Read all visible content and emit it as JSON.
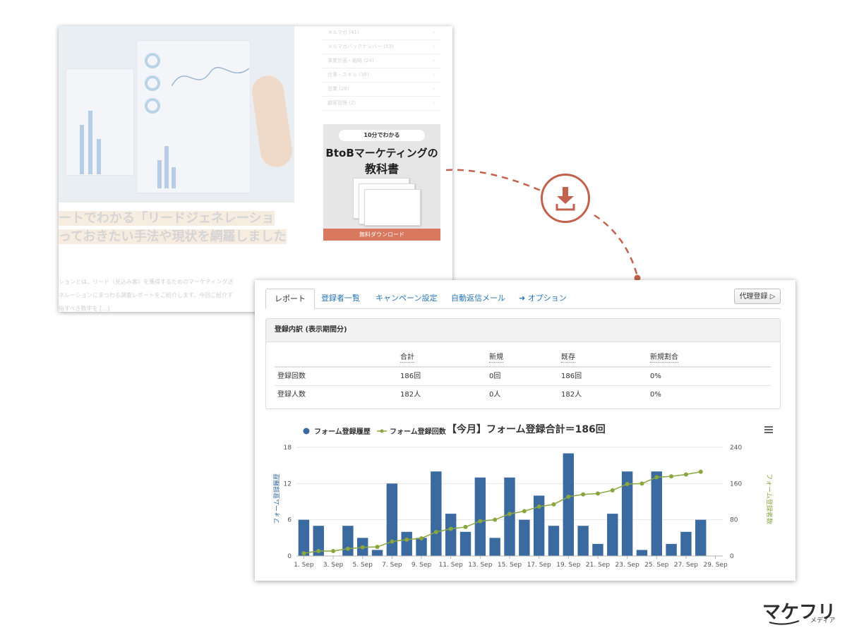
{
  "background_article": {
    "categories": [
      "メルマガ (41)",
      "メルマガバックナンバー (53)",
      "事業計画・戦略 (24)",
      "仕事・スキル (38)",
      "営業 (28)",
      "顧客管理 (2)"
    ],
    "headline_line1": "ートでわかる「リードジェネレーショ",
    "headline_line2": "っておきたい手法や現状を網羅しました",
    "excerpt_lines": [
      "ションとは、リード（見込み客）を獲得するためのマーケティング活",
      "ネレーションにまつわる調査レポートをご紹介します。今回ご紹介す",
      "指すべき数字を […]"
    ],
    "ebook": {
      "pill": "10分でわかる",
      "title_line1": "BtoBマーケティングの",
      "title_line2": "教科書",
      "download_button": "無料ダウンロード"
    }
  },
  "accent_color": "#c2624c",
  "tabs": [
    {
      "label": "レポート",
      "active": true
    },
    {
      "label": "登録者一覧"
    },
    {
      "label": "キャンペーン設定"
    },
    {
      "label": "自動返信メール"
    },
    {
      "label": "➜ オプション"
    }
  ],
  "proxy_button": "代理登録 ▷",
  "breakdown": {
    "title": "登録内訳 (表示期間分)",
    "headers": [
      "",
      "合計",
      "新規",
      "既存",
      "新規割合"
    ],
    "rows": [
      [
        "登録回数",
        "186回",
        "0回",
        "186回",
        "0%"
      ],
      [
        "登録人数",
        "182人",
        "0人",
        "182人",
        "0%"
      ]
    ]
  },
  "chart_data": {
    "type": "bar",
    "title": "【今月】フォーム登録合計＝186回",
    "x": [
      "1. Sep",
      "2. Sep",
      "3. Sep",
      "4. Sep",
      "5. Sep",
      "6. Sep",
      "7. Sep",
      "8. Sep",
      "9. Sep",
      "10. Sep",
      "11. Sep",
      "12. Sep",
      "13. Sep",
      "14. Sep",
      "15. Sep",
      "16. Sep",
      "17. Sep",
      "18. Sep",
      "19. Sep",
      "20. Sep",
      "21. Sep",
      "22. Sep",
      "23. Sep",
      "24. Sep",
      "25. Sep",
      "26. Sep",
      "27. Sep",
      "28. Sep",
      "29. Sep"
    ],
    "x_tick_labels": [
      "1. Sep",
      "3. Sep",
      "5. Sep",
      "7. Sep",
      "9. Sep",
      "11. Sep",
      "13. Sep",
      "15. Sep",
      "17. Sep",
      "19. Sep",
      "21. Sep",
      "23. Sep",
      "25. Sep",
      "27. Sep",
      "29. Sep"
    ],
    "series": [
      {
        "name": "フォーム登録履歴",
        "type": "bar",
        "axis": "left",
        "color": "#3b6aa0",
        "values": [
          6,
          5,
          0,
          5,
          3,
          1,
          12,
          4,
          3,
          14,
          7,
          4,
          13,
          3,
          13,
          6,
          10,
          5,
          17,
          5,
          2,
          7,
          14,
          1,
          14,
          2,
          4,
          6,
          null
        ]
      },
      {
        "name": "フォーム登録回数",
        "type": "line",
        "axis": "right",
        "color": "#8aa63f",
        "values": [
          6,
          11,
          11,
          16,
          19,
          20,
          32,
          36,
          39,
          53,
          60,
          64,
          77,
          80,
          93,
          99,
          109,
          114,
          131,
          136,
          138,
          145,
          159,
          160,
          174,
          176,
          180,
          186,
          null
        ]
      }
    ],
    "y_left": {
      "label": "フォーム登録履歴",
      "ticks": [
        0,
        6,
        12,
        18
      ],
      "range": [
        0,
        18
      ]
    },
    "y_right": {
      "label": "フォーム登録者数",
      "ticks": [
        0,
        80,
        160,
        240
      ],
      "range": [
        0,
        240
      ]
    },
    "legend_position": "top-left",
    "grid": true
  }
}
